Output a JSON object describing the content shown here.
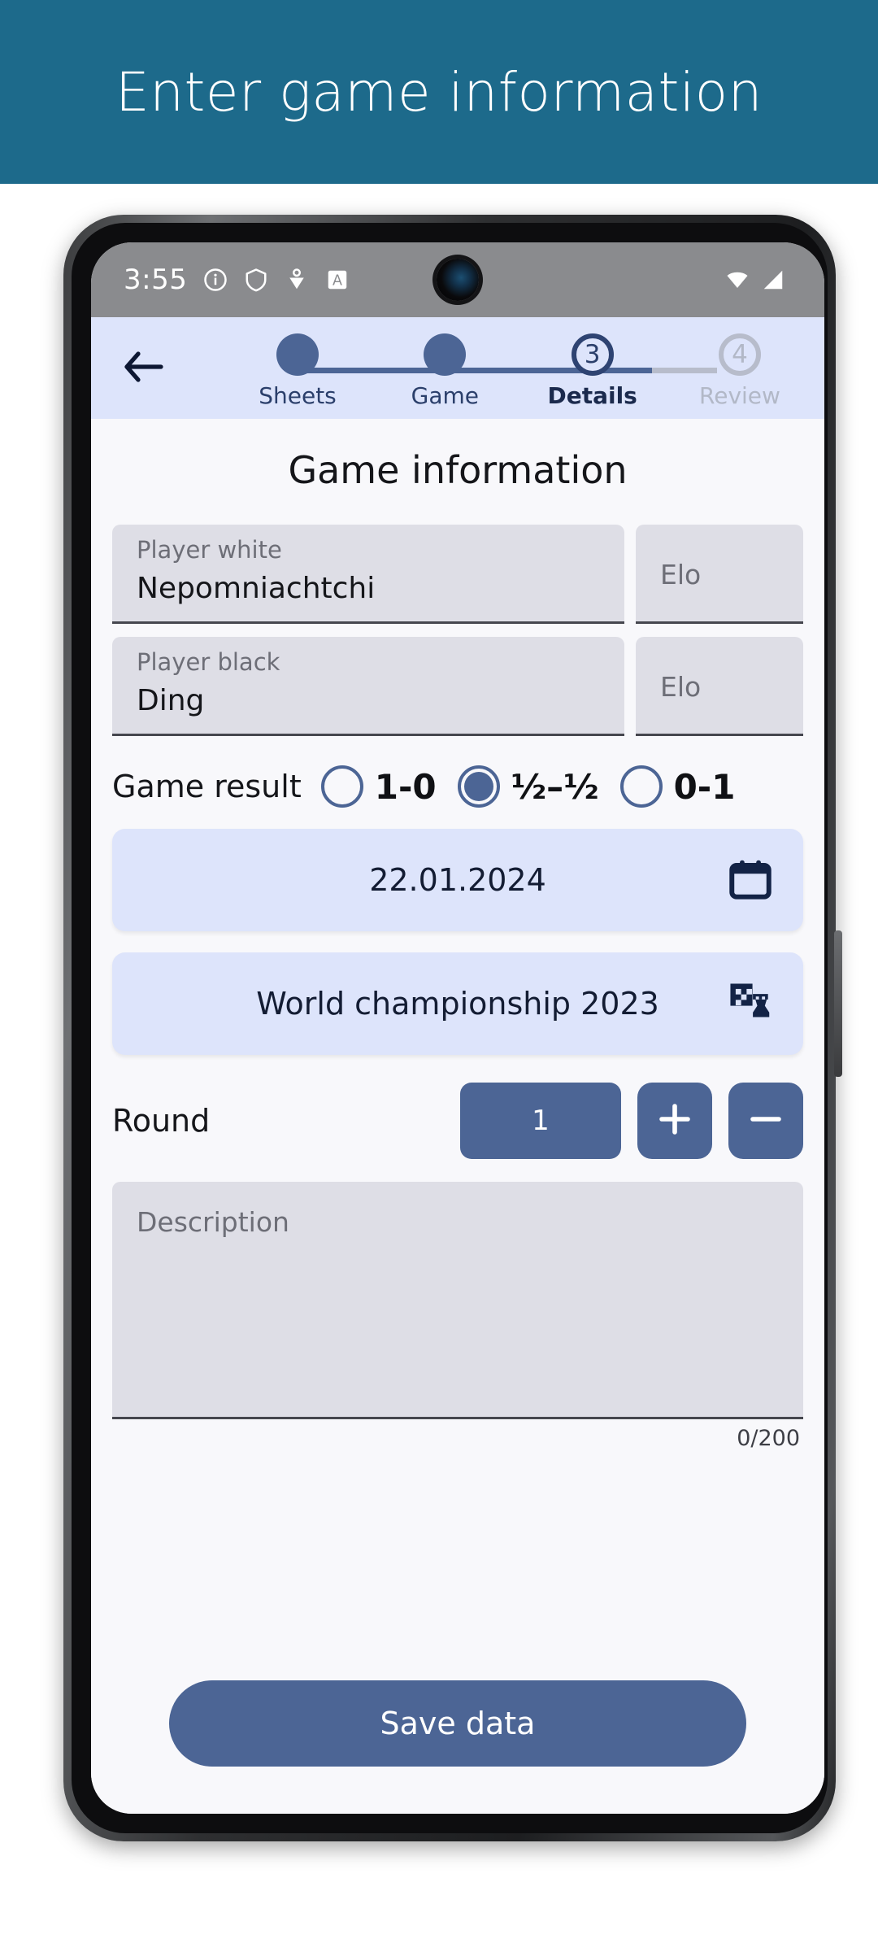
{
  "promo": {
    "title": "Enter game information"
  },
  "status_bar": {
    "time": "3:55",
    "left_icons": [
      "info-circle-icon",
      "shield-icon",
      "location-heart-icon",
      "letter-a-badge-icon"
    ],
    "right_icons": [
      "wifi-icon",
      "cellular-signal-icon"
    ]
  },
  "stepper": {
    "back_icon": "back-arrow-icon",
    "steps": [
      {
        "label": "Sheets",
        "number": "1",
        "state": "done"
      },
      {
        "label": "Game",
        "number": "2",
        "state": "done"
      },
      {
        "label": "Details",
        "number": "3",
        "state": "current"
      },
      {
        "label": "Review",
        "number": "4",
        "state": "pending"
      }
    ]
  },
  "page": {
    "title": "Game information",
    "fields": {
      "player_white": {
        "label": "Player white",
        "value": "Nepomniachtchi"
      },
      "elo_white": {
        "placeholder": "Elo",
        "value": ""
      },
      "player_black": {
        "label": "Player black",
        "value": "Ding"
      },
      "elo_black": {
        "placeholder": "Elo",
        "value": ""
      }
    },
    "game_result": {
      "label": "Game result",
      "options": [
        {
          "value": "1-0",
          "selected": false
        },
        {
          "value": "½–½",
          "selected": true
        },
        {
          "value": "0-1",
          "selected": false
        }
      ]
    },
    "date_picker": {
      "value": "22.01.2024",
      "icon": "calendar-icon"
    },
    "tournament_picker": {
      "value": "World championship 2023",
      "icon": "chessboard-rook-icon"
    },
    "round": {
      "label": "Round",
      "value": "1",
      "increment_icon": "plus-icon",
      "decrement_icon": "minus-icon"
    },
    "description": {
      "placeholder": "Description",
      "value": "",
      "counter": "0/200"
    },
    "save_button": {
      "label": "Save data"
    }
  },
  "colors": {
    "banner": "#1d6a8b",
    "accent": "#4c6595",
    "tile": "#dde4fb",
    "field": "#dedee6",
    "screen_bg": "#f8f8fb"
  }
}
